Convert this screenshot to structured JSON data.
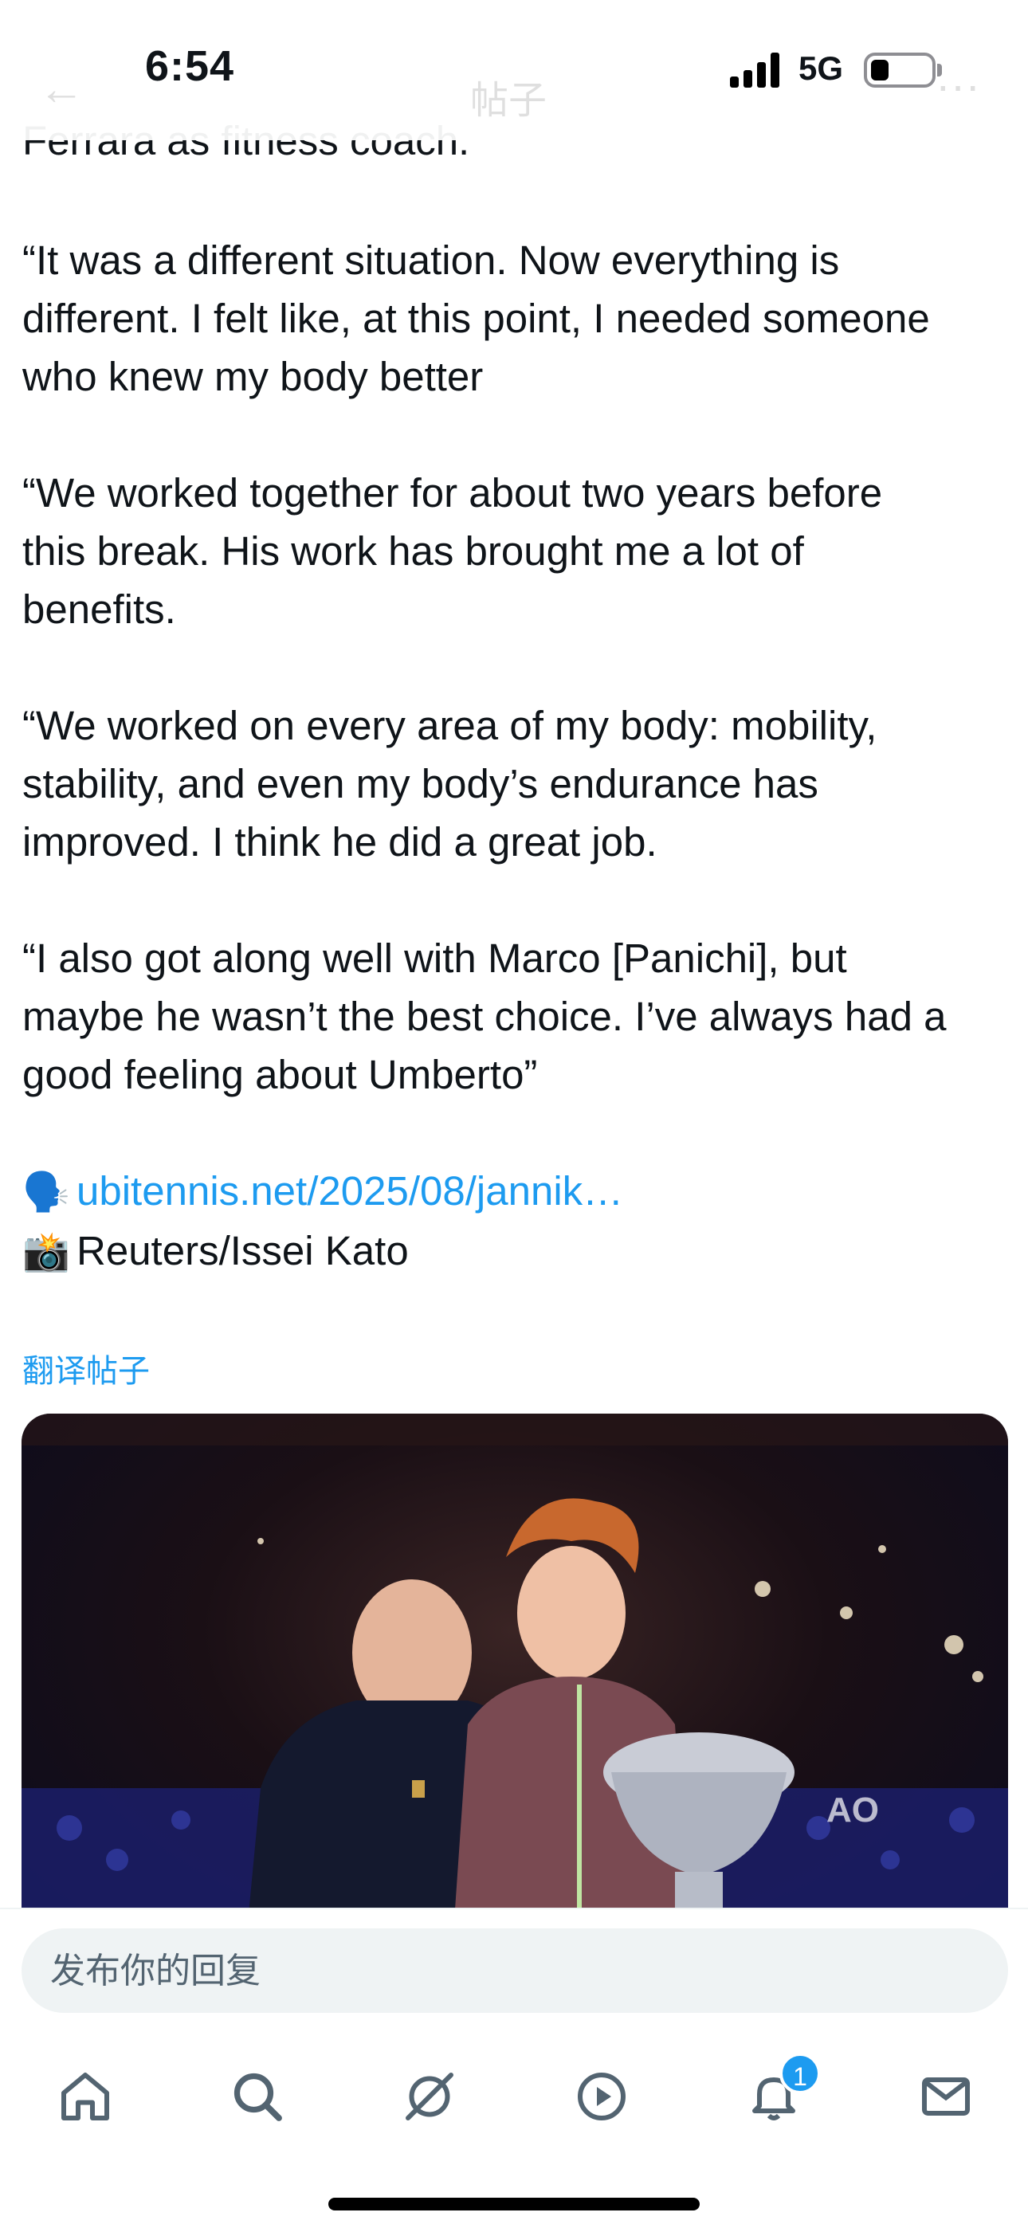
{
  "status": {
    "time": "6:54",
    "network": "5G"
  },
  "header": {
    "title": "帖子"
  },
  "tweet": {
    "clipped_line": "Ferrara as fitness coach.",
    "paragraphs": [
      [
        "“It was a different situation. Now everything is",
        "different. I felt like, at this point, I needed someone",
        "who knew my body better"
      ],
      [
        "“We worked together for about two years before",
        "this break. His work has brought me a lot of",
        "benefits."
      ],
      [
        "“We worked on every area of my body: mobility,",
        "stability, and even my body’s endurance has",
        "improved. I think he did a great job."
      ],
      [
        "“I also got along well with Marco [Panichi], but",
        "maybe he wasn’t the best choice. I’ve always had a",
        "good feeling about Umberto”"
      ]
    ],
    "source_emoji": "🗣️",
    "source_link": "ubitennis.net/2025/08/jannik…",
    "photo_emoji": "📸",
    "photo_credit": "Reuters/Issei Kato",
    "translate_label": "翻译帖子"
  },
  "reply": {
    "placeholder": "发布你的回复"
  },
  "nav": {
    "items": [
      {
        "name": "home",
        "icon": "home-icon"
      },
      {
        "name": "search",
        "icon": "search-icon"
      },
      {
        "name": "grok",
        "icon": "grok-icon"
      },
      {
        "name": "video",
        "icon": "play-icon"
      },
      {
        "name": "notifications",
        "icon": "bell-icon",
        "badge": "1"
      },
      {
        "name": "messages",
        "icon": "mail-icon"
      }
    ]
  }
}
